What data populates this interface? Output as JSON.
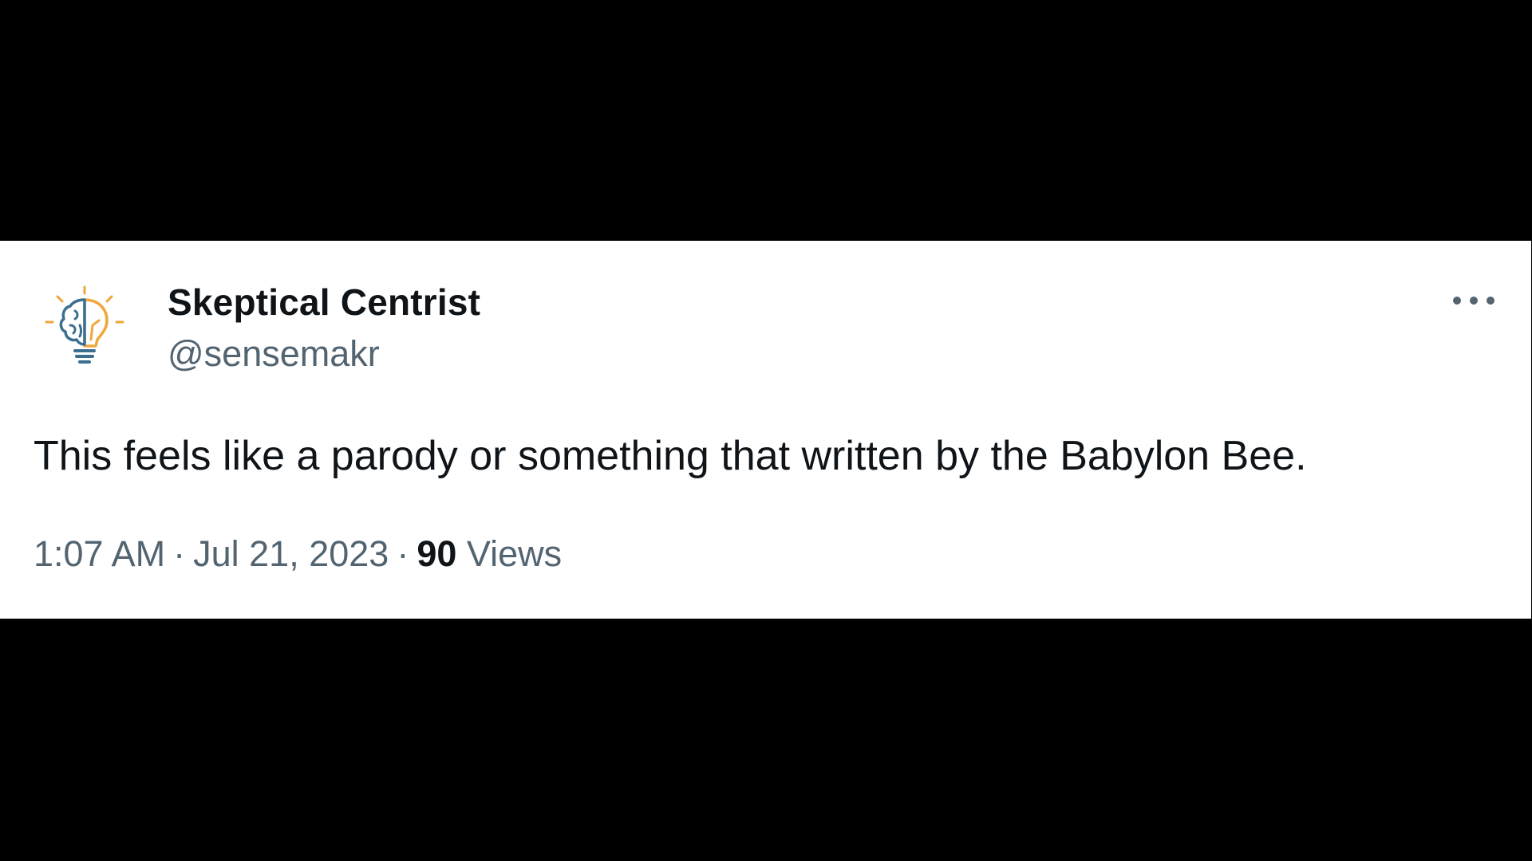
{
  "tweet": {
    "author": {
      "display_name": "Skeptical Centrist",
      "handle": "@sensemakr",
      "avatar_icon": "brain-lightbulb-icon"
    },
    "menu_icon": "more-options-icon",
    "text": "This feels like a parody or something that written by the Babylon Bee.",
    "timestamp": {
      "time": "1:07 AM",
      "date": "Jul 21, 2023"
    },
    "separator": "·",
    "views": {
      "count": "90",
      "label": "Views"
    }
  },
  "colors": {
    "background": "#000000",
    "card": "#ffffff",
    "primary_text": "#0f1419",
    "secondary_text": "#536471",
    "avatar_brain": "#3b6f91",
    "avatar_bulb": "#f0a73a"
  }
}
